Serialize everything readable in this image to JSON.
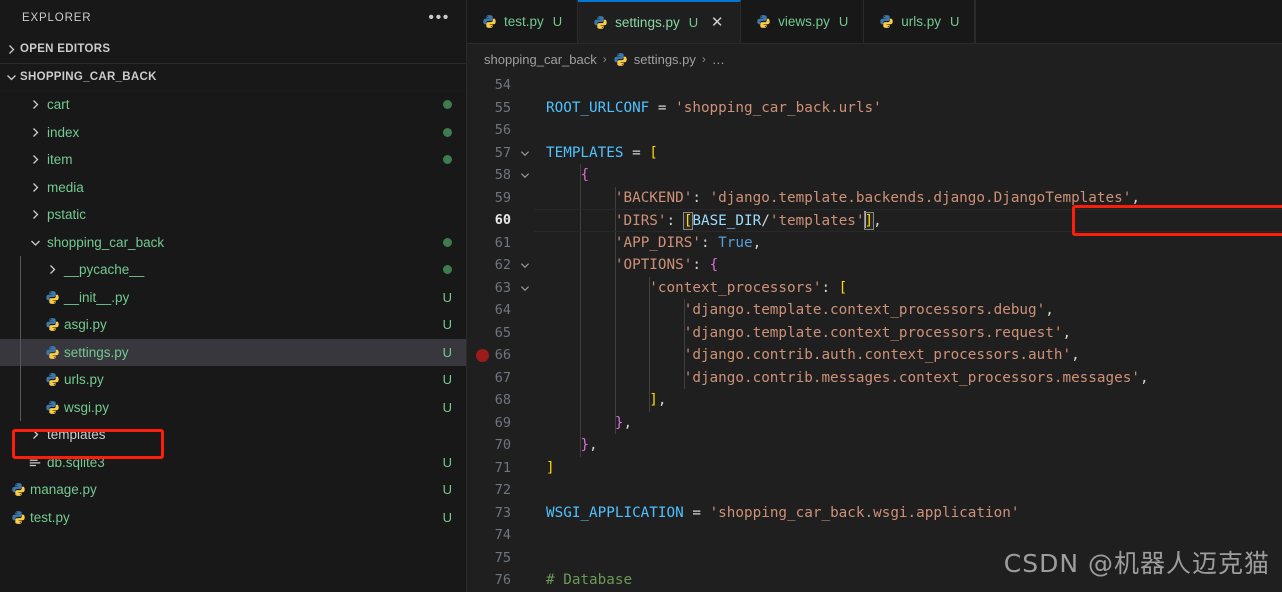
{
  "sidebar": {
    "title": "EXPLORER",
    "more_actions": "•••",
    "sections": [
      {
        "label": "OPEN EDITORS",
        "expanded": false
      },
      {
        "label": "SHOPPING_CAR_BACK",
        "expanded": true
      }
    ],
    "items": [
      {
        "label": "cart",
        "type": "folder",
        "depth": 1,
        "expanded": false,
        "dot": true,
        "badge": "",
        "icon": "chevron-right-icon"
      },
      {
        "label": "index",
        "type": "folder",
        "depth": 1,
        "expanded": false,
        "dot": true,
        "badge": "",
        "icon": "chevron-right-icon"
      },
      {
        "label": "item",
        "type": "folder",
        "depth": 1,
        "expanded": false,
        "dot": true,
        "badge": "",
        "icon": "chevron-right-icon"
      },
      {
        "label": "media",
        "type": "folder",
        "depth": 1,
        "expanded": false,
        "dot": false,
        "badge": "",
        "icon": "chevron-right-icon"
      },
      {
        "label": "pstatic",
        "type": "folder",
        "depth": 1,
        "expanded": false,
        "dot": false,
        "badge": "",
        "icon": "chevron-right-icon"
      },
      {
        "label": "shopping_car_back",
        "type": "folder",
        "depth": 1,
        "expanded": true,
        "dot": true,
        "badge": "",
        "icon": "chevron-down-icon"
      },
      {
        "label": "__pycache__",
        "type": "folder",
        "depth": 2,
        "expanded": false,
        "dot": true,
        "badge": "",
        "icon": "chevron-right-icon"
      },
      {
        "label": "__init__.py",
        "type": "python",
        "depth": 2,
        "expanded": false,
        "dot": false,
        "badge": "U",
        "icon": "python-file-icon"
      },
      {
        "label": "asgi.py",
        "type": "python",
        "depth": 2,
        "expanded": false,
        "dot": false,
        "badge": "U",
        "icon": "python-file-icon"
      },
      {
        "label": "settings.py",
        "type": "python",
        "depth": 2,
        "expanded": false,
        "dot": false,
        "badge": "U",
        "icon": "python-file-icon",
        "selected": true
      },
      {
        "label": "urls.py",
        "type": "python",
        "depth": 2,
        "expanded": false,
        "dot": false,
        "badge": "U",
        "icon": "python-file-icon"
      },
      {
        "label": "wsgi.py",
        "type": "python",
        "depth": 2,
        "expanded": false,
        "dot": false,
        "badge": "U",
        "icon": "python-file-icon"
      },
      {
        "label": "templates",
        "type": "folder",
        "depth": 1,
        "expanded": false,
        "dot": false,
        "badge": "",
        "icon": "chevron-right-icon",
        "plain": true,
        "highlighted": true
      },
      {
        "label": "db.sqlite3",
        "type": "db",
        "depth": 1,
        "expanded": false,
        "dot": false,
        "badge": "U",
        "icon": "database-file-icon"
      },
      {
        "label": "manage.py",
        "type": "python",
        "depth": 0,
        "expanded": false,
        "dot": false,
        "badge": "U",
        "icon": "python-file-icon"
      },
      {
        "label": "test.py",
        "type": "python",
        "depth": 0,
        "expanded": false,
        "dot": false,
        "badge": "U",
        "icon": "python-file-icon"
      }
    ]
  },
  "tabs": [
    {
      "label": "test.py",
      "badge": "U",
      "active": false,
      "closable": false
    },
    {
      "label": "settings.py",
      "badge": "U",
      "active": true,
      "closable": true
    },
    {
      "label": "views.py",
      "badge": "U",
      "active": false,
      "closable": false
    },
    {
      "label": "urls.py",
      "badge": "U",
      "active": false,
      "closable": false
    }
  ],
  "breadcrumb": {
    "project": "shopping_car_back",
    "file": "settings.py",
    "more": "…",
    "separator": "›"
  },
  "editor": {
    "first_line": 54,
    "active_line": 60,
    "breakpoint_line": 66,
    "code": [
      {
        "n": 54,
        "fold": "",
        "text": ""
      },
      {
        "n": 55,
        "fold": "",
        "text": "ROOT_URLCONF = 'shopping_car_back.urls'"
      },
      {
        "n": 56,
        "fold": "",
        "text": ""
      },
      {
        "n": 57,
        "fold": "v",
        "text": "TEMPLATES = ["
      },
      {
        "n": 58,
        "fold": "v",
        "text": "    {"
      },
      {
        "n": 59,
        "fold": "",
        "text": "        'BACKEND': 'django.template.backends.django.DjangoTemplates',"
      },
      {
        "n": 60,
        "fold": "",
        "text": "        'DIRS': [BASE_DIR/'templates'],"
      },
      {
        "n": 61,
        "fold": "",
        "text": "        'APP_DIRS': True,"
      },
      {
        "n": 62,
        "fold": "v",
        "text": "        'OPTIONS': {"
      },
      {
        "n": 63,
        "fold": "v",
        "text": "            'context_processors': ["
      },
      {
        "n": 64,
        "fold": "",
        "text": "                'django.template.context_processors.debug',"
      },
      {
        "n": 65,
        "fold": "",
        "text": "                'django.template.context_processors.request',"
      },
      {
        "n": 66,
        "fold": "",
        "text": "                'django.contrib.auth.context_processors.auth',"
      },
      {
        "n": 67,
        "fold": "",
        "text": "                'django.contrib.messages.context_processors.messages',"
      },
      {
        "n": 68,
        "fold": "",
        "text": "            ],"
      },
      {
        "n": 69,
        "fold": "",
        "text": "        },"
      },
      {
        "n": 70,
        "fold": "",
        "text": "    },"
      },
      {
        "n": 71,
        "fold": "",
        "text": "]"
      },
      {
        "n": 72,
        "fold": "",
        "text": ""
      },
      {
        "n": 73,
        "fold": "",
        "text": "WSGI_APPLICATION = 'shopping_car_back.wsgi.application'"
      },
      {
        "n": 74,
        "fold": "",
        "text": ""
      },
      {
        "n": 75,
        "fold": "",
        "text": ""
      },
      {
        "n": 76,
        "fold": "",
        "text": "# Database"
      }
    ]
  },
  "annotations": {
    "sidebar_target": "templates",
    "editor_target": "'DIRS': [BASE_DIR/'templates'],",
    "color": "#fb1e0b"
  },
  "watermark": "CSDN @机器人迈克猫",
  "theme": {
    "sidebar_bg": "#181818",
    "editor_bg": "#1f1f1f",
    "accent": "#0078d4",
    "git_modified": "#73c991"
  }
}
